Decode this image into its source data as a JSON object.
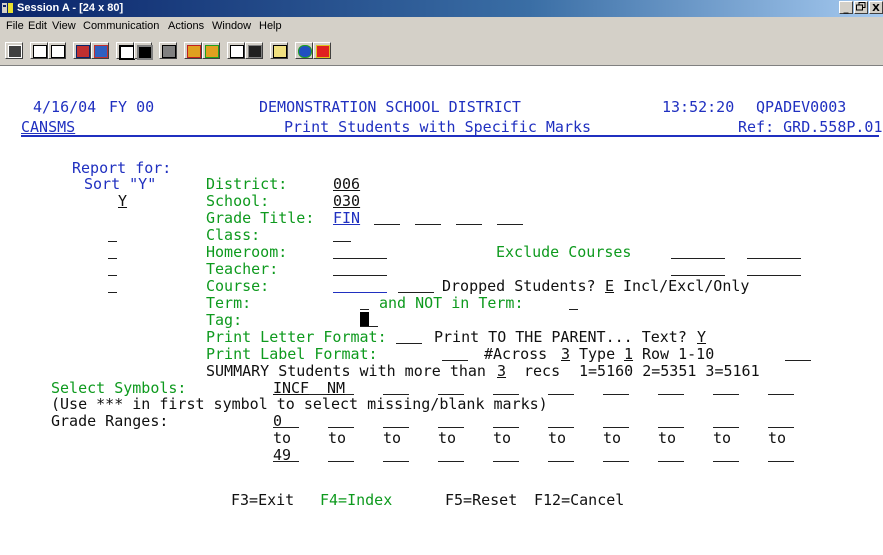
{
  "window": {
    "title": "Session A - [24 x 80]",
    "controls": [
      "_",
      "б",
      "X"
    ]
  },
  "menu": [
    "File",
    "Edit",
    "View",
    "Communication",
    "Actions",
    "Window",
    "Help"
  ],
  "toolbar": [
    "print-icon",
    "copy-icon",
    "paste-icon",
    "send-icon",
    "receive-icon",
    "display-icon",
    "display2-icon",
    "macro-icon",
    "record-icon",
    "playback-icon",
    "stop-icon",
    "pause-icon",
    "clipboard-icon",
    "globe-icon",
    "ruler-icon"
  ],
  "header": {
    "date": "4/16/04",
    "fy": "FY 00",
    "district_name": "DEMONSTRATION SCHOOL DISTRICT",
    "time": "13:52:20",
    "session": "QPADEV0003",
    "program": "CANSMS",
    "screen_title": "Print Students with Specific Marks",
    "ref": "Ref: GRD.558P.01"
  },
  "form": {
    "report_for": "Report for:",
    "sort_label": "Sort \"Y\"",
    "district_label": "District:",
    "district_value": "006",
    "school_label": "School:",
    "school_value": "030",
    "school_sort": "Y",
    "grade_title_label": "Grade Title:",
    "grade_title_value": "FIN",
    "class_label": "Class:",
    "homeroom_label": "Homeroom:",
    "exclude_courses_label": "Exclude Courses",
    "teacher_label": "Teacher:",
    "course_label": "Course:",
    "dropped_label": "Dropped Students?",
    "dropped_value": "E",
    "dropped_options": "Incl/Excl/Only",
    "term_label": "Term:",
    "not_in_term_label": "and NOT in Term:",
    "tag_label": "Tag:",
    "letter_format_label": "Print Letter Format:",
    "print_parent_label": "Print TO THE PARENT... Text?",
    "print_parent_value": "Y",
    "label_format_label": "Print Label Format:",
    "across_label": "#Across",
    "across_value": "3",
    "type_label": "Type",
    "type_value": "1",
    "row_label": "Row 1-10",
    "summary_label": "SUMMARY Students with more than",
    "summary_value": "3",
    "summary_recs": "recs",
    "summary_codes": "1=5160 2=5351 3=5161",
    "select_symbols_label": "Select Symbols:",
    "symbols": [
      "INC",
      "F",
      "NM",
      "",
      "",
      "",
      "",
      "",
      "",
      ""
    ],
    "symbols_note": "(Use *** in first symbol to select missing/blank marks)",
    "grade_ranges_label": "Grade Ranges:",
    "range_from": [
      "0",
      "",
      "",
      "",
      "",
      "",
      "",
      "",
      "",
      ""
    ],
    "to_label": "to",
    "range_to": [
      "49",
      "",
      "",
      "",
      "",
      "",
      "",
      "",
      "",
      ""
    ]
  },
  "fkeys": {
    "f3": "F3=Exit",
    "f4": "F4=Index",
    "f5": "F5=Reset",
    "f12": "F12=Cancel"
  }
}
